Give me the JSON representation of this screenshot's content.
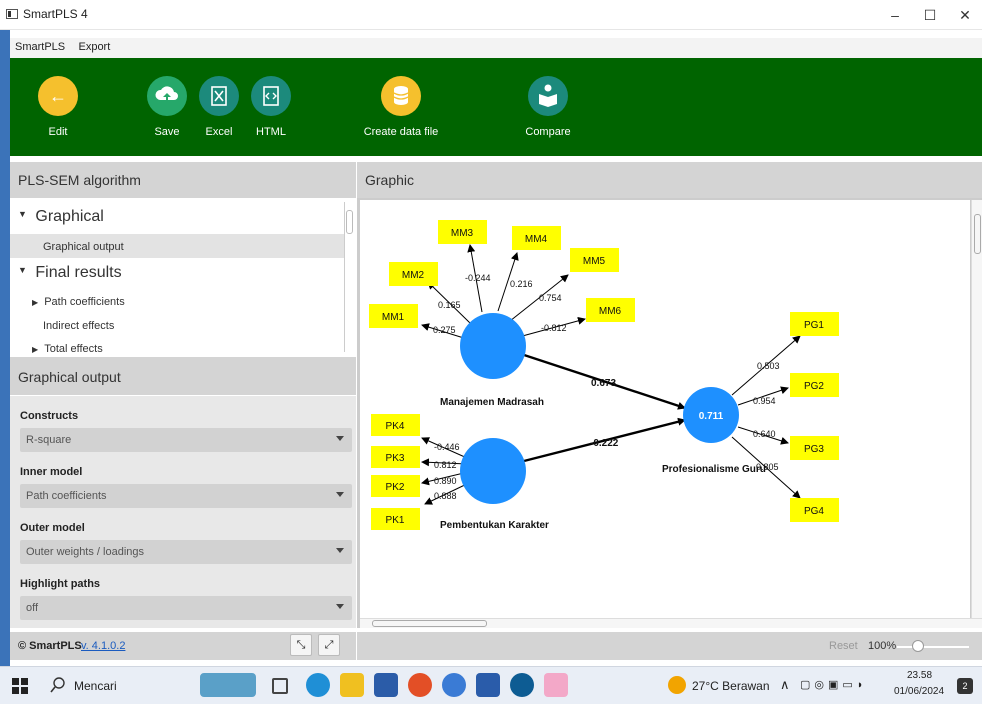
{
  "window": {
    "title": "SmartPLS 4"
  },
  "menu": [
    "SmartPLS",
    "Export"
  ],
  "toolbar": {
    "edit": "Edit",
    "save": "Save",
    "excel": "Excel",
    "html": "HTML",
    "create_data_file": "Create data file",
    "compare": "Compare"
  },
  "left_panel": {
    "title": "PLS-SEM algorithm",
    "tree": {
      "graphical": "Graphical",
      "graphical_output": "Graphical output",
      "final_results": "Final results",
      "path_coefficients": "Path coefficients",
      "indirect_effects": "Indirect effects",
      "total_effects": "Total effects"
    },
    "options_title": "Graphical output",
    "constructs_label": "Constructs",
    "constructs_value": "R-square",
    "inner_model_label": "Inner model",
    "inner_model_value": "Path coefficients",
    "outer_model_label": "Outer model",
    "outer_model_value": "Outer weights / loadings",
    "highlight_label": "Highlight paths",
    "highlight_value": "off",
    "copyright": "© SmartPLS",
    "version": "v. 4.1.0.2"
  },
  "graphic": {
    "title": "Graphic",
    "reset": "Reset",
    "zoom": "100%",
    "constructs": {
      "mm": "Manajemen Madrasah",
      "pk": "Pembentukan Karakter",
      "pg": "Profesionalisme Guru",
      "pg_r2": "0.711"
    },
    "indicators": {
      "mm": [
        "MM1",
        "MM2",
        "MM3",
        "MM4",
        "MM5",
        "MM6"
      ],
      "pk": [
        "PK4",
        "PK3",
        "PK2",
        "PK1"
      ],
      "pg": [
        "PG1",
        "PG2",
        "PG3",
        "PG4"
      ]
    },
    "weights": {
      "mm": [
        "0.275",
        "0.165",
        "-0.244",
        "0.216",
        "0.754",
        "-0.812"
      ],
      "pk": [
        "-0.446",
        "0.812",
        "0.890",
        "0.888"
      ],
      "pg": [
        "0.503",
        "0.954",
        "0.640",
        "0.805"
      ]
    },
    "paths": {
      "mm_pg": "0.673",
      "pk_pg": "-0.222"
    },
    "colors": {
      "construct": "#1E90FF",
      "indicator": "#FFFF00"
    }
  },
  "taskbar": {
    "search": "Mencari",
    "weather": "27°C Berawan",
    "time": "23.58",
    "date": "01/06/2024",
    "notif_count": "2"
  }
}
